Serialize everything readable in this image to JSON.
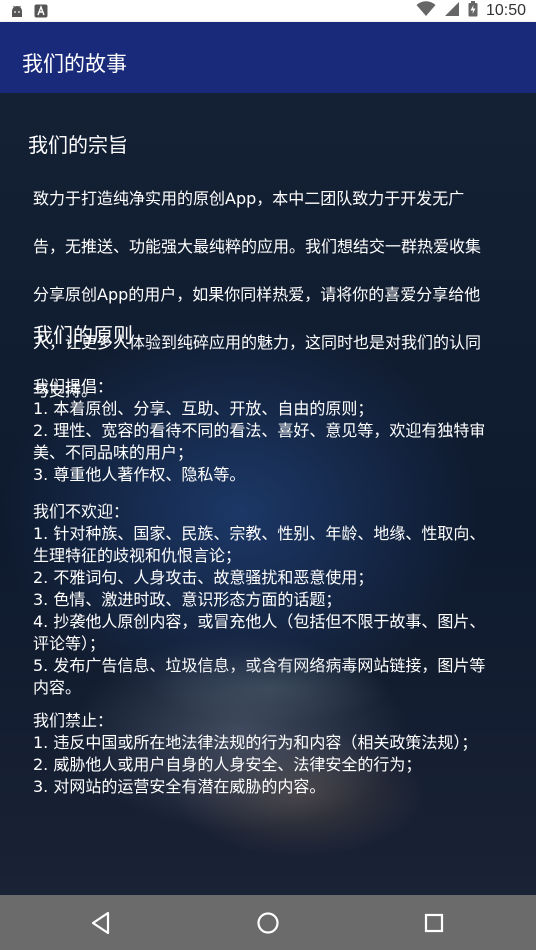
{
  "status_bar": {
    "time": "10:50",
    "icons": [
      "android-icon",
      "notification-icon",
      "wifi-icon",
      "signal-icon",
      "battery-icon"
    ]
  },
  "app_bar": {
    "title": "我们的故事"
  },
  "purpose": {
    "heading": "我们的宗旨",
    "lines": [
      "致力于打造纯净实用的原创App，本中二团队致力于开发无广",
      "告，无推送、功能强大最纯粹的应用。我们想结交一群热爱收集",
      "分享原创App的用户，如果你同样热爱，请将你的喜爱分享给他",
      "人，让更多人体验到纯碎应用的魅力，这同时也是对我们的认同",
      "与支持。"
    ]
  },
  "principles": {
    "heading": "我们的原则",
    "advocate": {
      "title": "我们提倡：",
      "items": [
        "1. 本着原创、分享、互助、开放、自由的原则；",
        "2. 理性、宽容的看待不同的看法、喜好、意见等，欢迎有独特审",
        "美、不同品味的用户；",
        "3. 尊重他人著作权、隐私等。"
      ]
    },
    "unwelcome": {
      "title": "我们不欢迎：",
      "items": [
        "1. 针对种族、国家、民族、宗教、性别、年龄、地缘、性取向、",
        "生理特征的歧视和仇恨言论；",
        "2. 不雅词句、人身攻击、故意骚扰和恶意使用；",
        "3. 色情、激进时政、意识形态方面的话题；",
        "4. 抄袭他人原创内容，或冒充他人（包括但不限于故事、图片、",
        "评论等）；",
        "5. 发布广告信息、垃圾信息，或含有网络病毒网站链接，图片等",
        "内容。"
      ]
    },
    "forbidden": {
      "title": "我们禁止：",
      "items": [
        "1. 违反中国或所在地法律法规的行为和内容（相关政策法规）；",
        "2. 威胁他人或用户自身的人身安全、法律安全的行为；",
        "3. 对网站的运营安全有潜在威胁的内容。"
      ]
    }
  },
  "nav_bar": {
    "icons": [
      "back-icon",
      "home-icon",
      "recent-apps-icon"
    ]
  },
  "colors": {
    "app_bar": "#1a2a7a",
    "nav_bar": "#6b6b6b",
    "status_bar": "#ffffff",
    "text": "#ffffff"
  }
}
